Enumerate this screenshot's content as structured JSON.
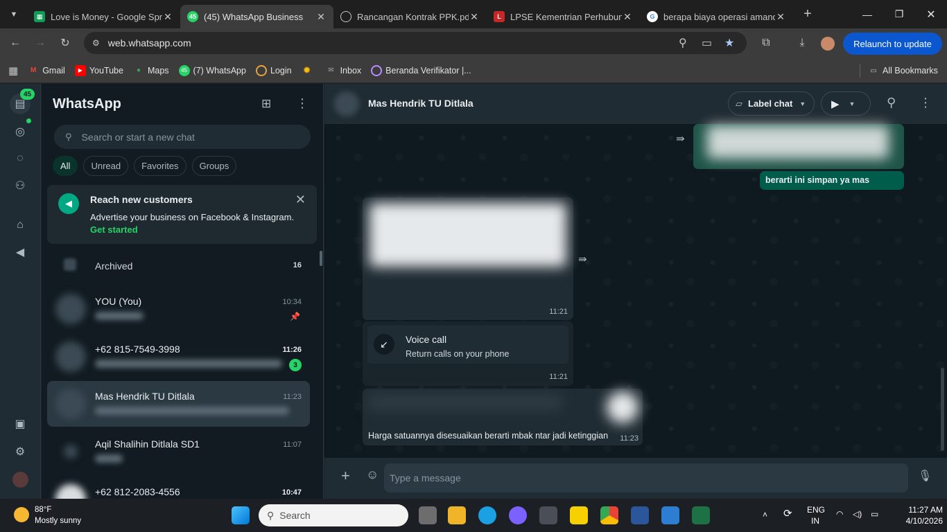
{
  "browser": {
    "tabs": [
      {
        "title": "Love is Money - Google Spre",
        "fav": "sheets"
      },
      {
        "title": "(45) WhatsApp Business",
        "fav": "wa",
        "fav_text": "45"
      },
      {
        "title": "Rancangan Kontrak PPK.pdf",
        "fav": "globe"
      },
      {
        "title": "LPSE Kementrian Perhubung",
        "fav": "lpse"
      },
      {
        "title": "berapa biaya operasi amand",
        "fav": "google"
      }
    ],
    "url": "web.whatsapp.com",
    "relaunch": "Relaunch to update",
    "bookmarks": [
      {
        "label": "Gmail"
      },
      {
        "label": "YouTube"
      },
      {
        "label": "Maps"
      },
      {
        "label": "(7) WhatsApp"
      },
      {
        "label": "Login"
      },
      {
        "label": ""
      },
      {
        "label": "Inbox"
      },
      {
        "label": "Beranda Verifikator |..."
      }
    ],
    "all_bookmarks": "All Bookmarks"
  },
  "rail": {
    "badge": "45"
  },
  "sidebar": {
    "title": "WhatsApp",
    "search_placeholder": "Search or start a new chat",
    "filters": [
      "All",
      "Unread",
      "Favorites",
      "Groups"
    ],
    "promo": {
      "title": "Reach new customers",
      "desc": "Advertise your business on Facebook & Instagram.",
      "cta": "Get started"
    },
    "archived": {
      "label": "Archived",
      "count": "16"
    },
    "chats": [
      {
        "name": "YOU (You)",
        "time": "10:34"
      },
      {
        "name": "+62 815-7549-3998",
        "time": "11:26",
        "unread": "3"
      },
      {
        "name": "Mas Hendrik TU Ditlala",
        "time": "11:23"
      },
      {
        "name": "Aqil Shalihin Ditlala SD1",
        "time": "11:07"
      },
      {
        "name": "+62 812-2083-4556",
        "time": "10:47"
      }
    ]
  },
  "conversation": {
    "name": "Mas Hendrik TU Ditlala",
    "label_chat": "Label chat",
    "messages": {
      "m1_text": "berarti ini simpan ya mas",
      "m2_time": "11:21",
      "call_title": "Voice call",
      "call_sub": "Return calls on your phone",
      "call_time": "11:21",
      "m4_text": "Harga satuannya disesuaikan berarti mbak ntar jadi ketinggian",
      "m4_time": "11:23"
    },
    "compose_placeholder": "Type a message"
  },
  "taskbar": {
    "temp": "88°F",
    "weather": "Mostly sunny",
    "search": "Search",
    "lang1": "ENG",
    "lang2": "IN",
    "time": "11:27 AM",
    "date": "4/10/2026"
  }
}
